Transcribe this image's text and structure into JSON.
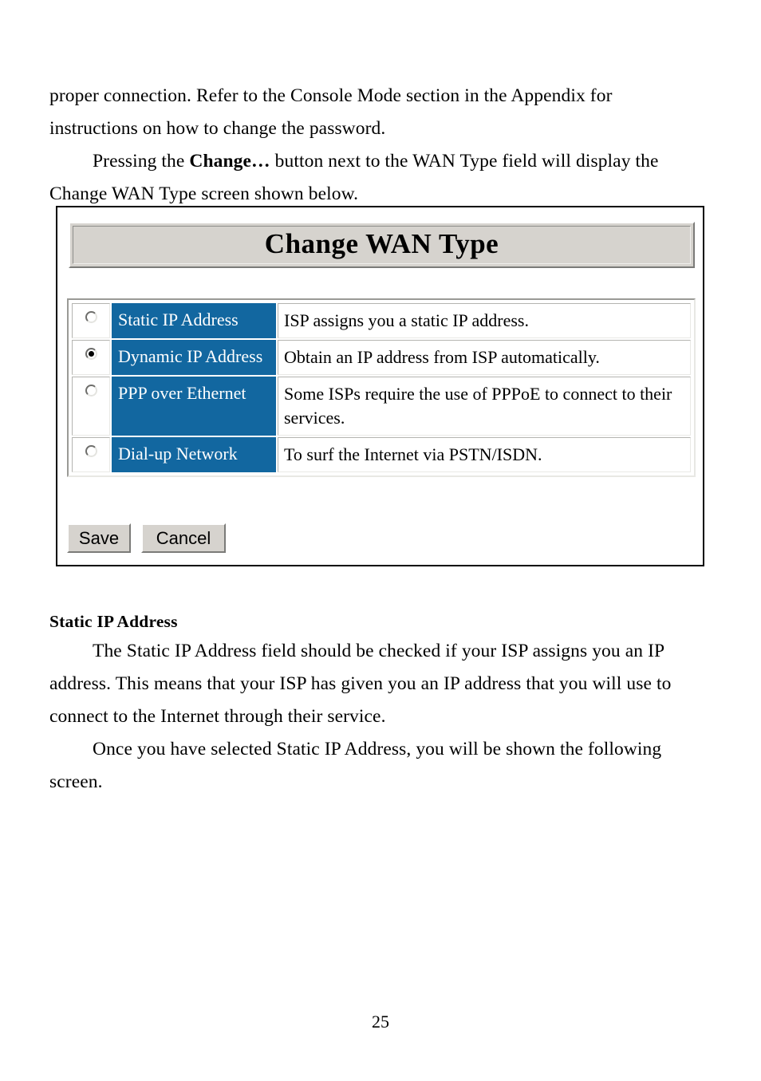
{
  "document": {
    "page_number": "25",
    "paragraphs_top": [
      {
        "id": "p1",
        "runs": [
          {
            "text": "proper connection. Refer to the Console Mode section in the Appendix for instructions on how to change the password.",
            "bold": false
          }
        ],
        "indent": false
      },
      {
        "id": "p2",
        "runs": [
          {
            "text": "Pressing the ",
            "bold": false
          },
          {
            "text": "Change…",
            "bold": true
          },
          {
            "text": " button next to the WAN Type field will display the Change WAN Type screen shown below.",
            "bold": false
          }
        ],
        "indent": true
      }
    ],
    "section": {
      "heading": "Static IP Address",
      "paragraphs": [
        {
          "id": "p3",
          "runs": [
            {
              "text": "The Static IP Address field should be checked if your ISP assigns you an IP address. This means that your ISP has given you an IP address that you will use to connect to the Internet through their service.",
              "bold": false
            }
          ],
          "indent": true
        },
        {
          "id": "p4",
          "runs": [
            {
              "text": "Once you have selected Static IP Address, you will be shown the following screen.",
              "bold": false
            }
          ],
          "indent": true
        }
      ]
    }
  },
  "figure": {
    "banner_title": "Change WAN Type",
    "table": {
      "rows": [
        {
          "id": "static-ip-address",
          "label": "Static IP Address",
          "description": "ISP assigns you a static IP address.",
          "selected": false
        },
        {
          "id": "dynamic-ip-address",
          "label": "Dynamic IP Address",
          "description": "Obtain an IP address from ISP automatically.",
          "selected": true
        },
        {
          "id": "ppp-over-ethernet",
          "label": "PPP over Ethernet",
          "description": "Some ISPs require the use of PPPoE to connect to their services.",
          "selected": false
        },
        {
          "id": "dial-up-network",
          "label": "Dial-up Network",
          "description": "To surf the Internet via PSTN/ISDN.",
          "selected": false
        }
      ]
    },
    "buttons": {
      "save_label": "Save",
      "cancel_label": "Cancel"
    },
    "colors": {
      "label_cell_background": "#1267a0",
      "label_cell_text": "#ffffff",
      "chrome_face": "#d6d3ce",
      "page_text": "#000000"
    }
  }
}
